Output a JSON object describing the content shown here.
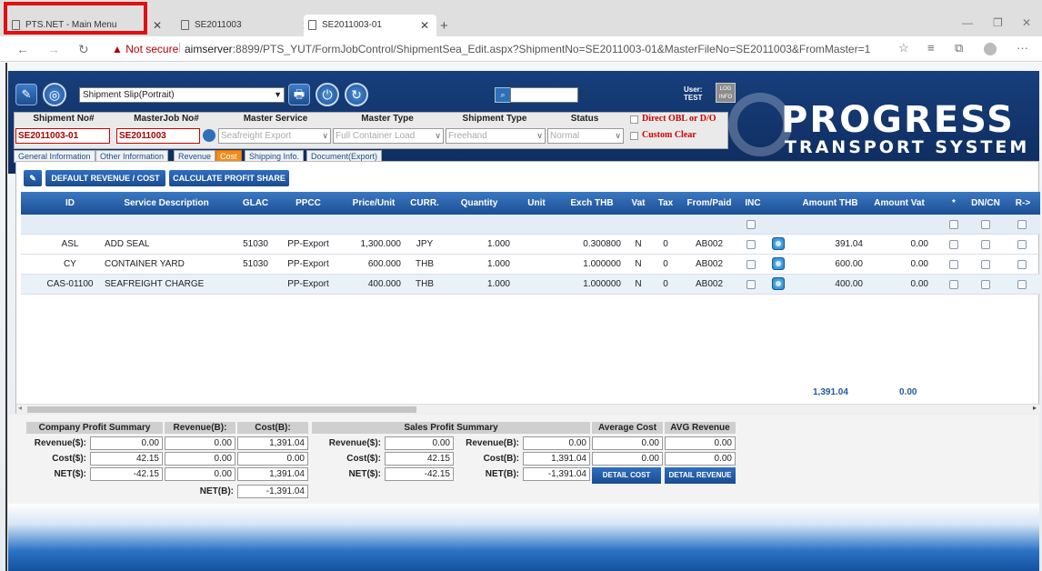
{
  "browser": {
    "tabs": [
      {
        "title": "PTS.NET - Main Menu"
      },
      {
        "title": "SE2011003"
      },
      {
        "title": "SE2011003-01"
      }
    ],
    "not_secure": "Not secure",
    "url_host": "aimserver",
    "url_rest": ":8899/PTS_YUT/FormJobControl/ShipmentSea_Edit.aspx?ShipmentNo=SE2011003-01&MasterFileNo=SE2011003&FromMaster=1"
  },
  "app": {
    "slip_select": "Shipment Slip(Portrait)",
    "user_label": "User:",
    "user_name": "TEST",
    "log_info": "LOG INFO",
    "logo_big": "PROGRESS",
    "logo_small": "TRANSPORT SYSTEM"
  },
  "header": {
    "labels": [
      "Shipment No#",
      "MasterJob No#",
      "Master Service",
      "Master Type",
      "Shipment Type",
      "Status"
    ],
    "shipment_no": "SE2011003-01",
    "masterjob_no": "SE2011003",
    "master_service": "Seafreight Export",
    "master_type": "Full Container Load",
    "shipment_type": "Freehand",
    "status": "Normal",
    "direct_obl": "Direct OBL or D/O",
    "custom_clear": "Custom Clear"
  },
  "tabs": [
    "General Information",
    "Other Information",
    "Revenue",
    "Cost",
    "Shipping Info.",
    "Document(Export)"
  ],
  "actions": {
    "default": "DEFAULT REVENUE / COST",
    "calc": "CALCULATE PROFIT SHARE"
  },
  "grid": {
    "columns": [
      "ID",
      "Service Description",
      "GLAC",
      "PPCC",
      "Price/Unit",
      "CURR.",
      "Quantity",
      "Unit",
      "Exch THB",
      "Vat",
      "Tax",
      "From/Paid",
      "INC",
      "",
      "Amount THB",
      "Amount Vat",
      "*",
      "DN/CN",
      "R->"
    ],
    "rows": [
      {
        "id": "ASL",
        "desc": "ADD SEAL",
        "glac": "51030",
        "ppcc": "PP-Export",
        "price": "1,300.000",
        "curr": "JPY",
        "qty": "1.000",
        "unit": "",
        "exch": "0.300800",
        "vat": "N",
        "tax": "0",
        "paid": "AB002",
        "amt": "391.04",
        "amtvat": "0.00"
      },
      {
        "id": "CY",
        "desc": "CONTAINER YARD",
        "glac": "51030",
        "ppcc": "PP-Export",
        "price": "600.000",
        "curr": "THB",
        "qty": "1.000",
        "unit": "",
        "exch": "1.000000",
        "vat": "N",
        "tax": "0",
        "paid": "AB002",
        "amt": "600.00",
        "amtvat": "0.00"
      },
      {
        "id": "CAS-01100",
        "desc": "SEAFREIGHT CHARGE",
        "glac": "",
        "ppcc": "PP-Export",
        "price": "400.000",
        "curr": "THB",
        "qty": "1.000",
        "unit": "",
        "exch": "1.000000",
        "vat": "N",
        "tax": "0",
        "paid": "AB002",
        "amt": "400.00",
        "amtvat": "0.00"
      }
    ],
    "total_thb": "1,391.04",
    "total_vat": "0.00"
  },
  "summary": {
    "company_title": "Company Profit Summary",
    "revenue_b": "Revenue(B):",
    "cost_b": "Cost(B):",
    "sales_title": "Sales Profit Summary",
    "avg_cost": "Average Cost",
    "avg_rev": "AVG Revenue",
    "lbl_rev_s": "Revenue($):",
    "lbl_cost_s": "Cost($):",
    "lbl_net_s": "NET($):",
    "lbl_net_b": "NET(B):",
    "lbl_rev_b": "Revenue(B):",
    "lbl_cost_b": "Cost(B):",
    "c_rev_s": "0.00",
    "c_rev_b": "0.00",
    "c_cost_b1": "1,391.04",
    "c_cost_s": "42.15",
    "c_cost_b": "0.00",
    "c_cost_b2": "0.00",
    "c_net_s": "-42.15",
    "c_net_b": "0.00",
    "c_net_b2": "1,391.04",
    "c_net_total": "-1,391.04",
    "s_rev_s": "0.00",
    "s_rev_b": "0.00",
    "s_avg_cost1": "0.00",
    "s_avg_rev1": "0.00",
    "s_cost_s": "42.15",
    "s_cost_b": "1,391.04",
    "s_avg_cost2": "0.00",
    "s_avg_rev2": "0.00",
    "s_net_s": "-42.15",
    "s_net_b": "-1,391.04",
    "detail_cost": "DETAIL COST",
    "detail_rev": "DETAIL REVENUE"
  }
}
